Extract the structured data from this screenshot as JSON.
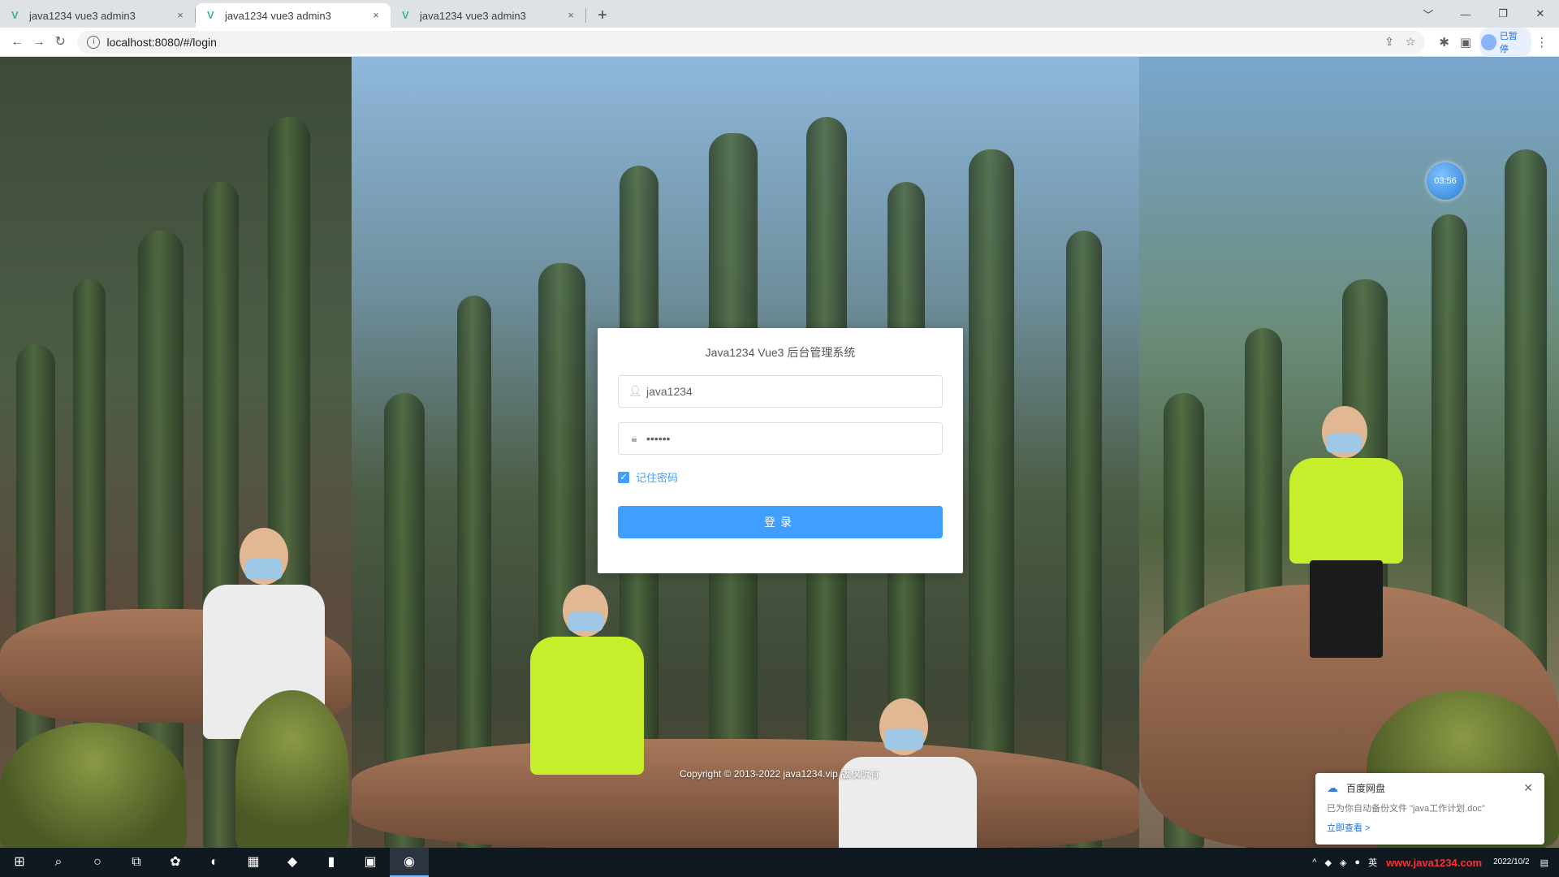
{
  "browser": {
    "tabs": [
      {
        "title": "java1234 vue3 admin3",
        "active": false
      },
      {
        "title": "java1234 vue3 admin3",
        "active": true
      },
      {
        "title": "java1234 vue3 admin3",
        "active": false
      }
    ],
    "tab_close_glyph": "×",
    "new_tab_glyph": "+",
    "url": "localhost:8080/#/login",
    "profile_label": "已暂停",
    "window_controls": [
      "﹀",
      "—",
      "❐",
      "✕"
    ]
  },
  "page": {
    "clock_bubble": "03:56",
    "login": {
      "title": "Java1234 Vue3 后台管理系统",
      "username_value": "java1234",
      "password_value": "••••••",
      "remember_label": "记住密码",
      "remember_checked": true,
      "submit_label": "登录"
    },
    "copyright": "Copyright © 2013-2022 java1234.vip 版权所有"
  },
  "toast": {
    "title": "百度网盘",
    "message": "已为你自动备份文件 \"java工作计划.doc\"",
    "link": "立即查看 >"
  },
  "taskbar": {
    "watermark": "www.java1234.com",
    "date": "2022/10/2",
    "ime": "英"
  },
  "colors": {
    "primary": "#409eff",
    "tab_strip": "#dee1e6",
    "taskbar": "#101820"
  }
}
